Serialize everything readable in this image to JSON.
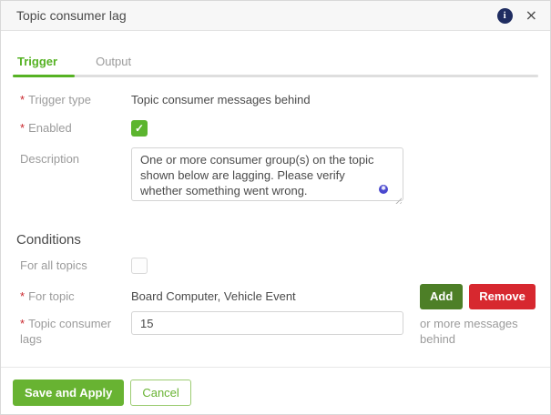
{
  "dialog": {
    "title": "Topic consumer lag"
  },
  "icons": {
    "info": "i",
    "close": "×",
    "checkmark": "✓",
    "insert_badge": "✱"
  },
  "required_marker": "*",
  "tabs": {
    "trigger": "Trigger",
    "output": "Output",
    "active_tab": "Trigger"
  },
  "form": {
    "trigger_type": {
      "label": "Trigger type",
      "required": true,
      "value": "Topic consumer messages behind"
    },
    "enabled": {
      "label": "Enabled",
      "required": true,
      "checked": true
    },
    "description": {
      "label": "Description",
      "required": false,
      "value": "One or more consumer group(s) on the topic shown below are lagging. Please verify whether something went wrong."
    }
  },
  "conditions": {
    "heading": "Conditions",
    "for_all_topics": {
      "label": "For all topics",
      "checked": false
    },
    "for_topic": {
      "label": "For topic",
      "required": true,
      "value": "Board Computer, Vehicle Event",
      "add_button": "Add",
      "remove_button": "Remove"
    },
    "topic_consumer_lags": {
      "label": "Topic consumer lags",
      "required": true,
      "value": "15",
      "suffix": "or more messages behind"
    }
  },
  "footer": {
    "save_button": "Save and Apply",
    "cancel_button": "Cancel"
  },
  "colors": {
    "primary_green": "#56b224",
    "checkbox_green": "#5cb52f",
    "add_green": "#4d7f27",
    "remove_red": "#d7282f",
    "save_green": "#68b332",
    "info_navy": "#1f2d61",
    "label_gray": "#9b9b9b",
    "text_dark": "#4a4a4a"
  }
}
